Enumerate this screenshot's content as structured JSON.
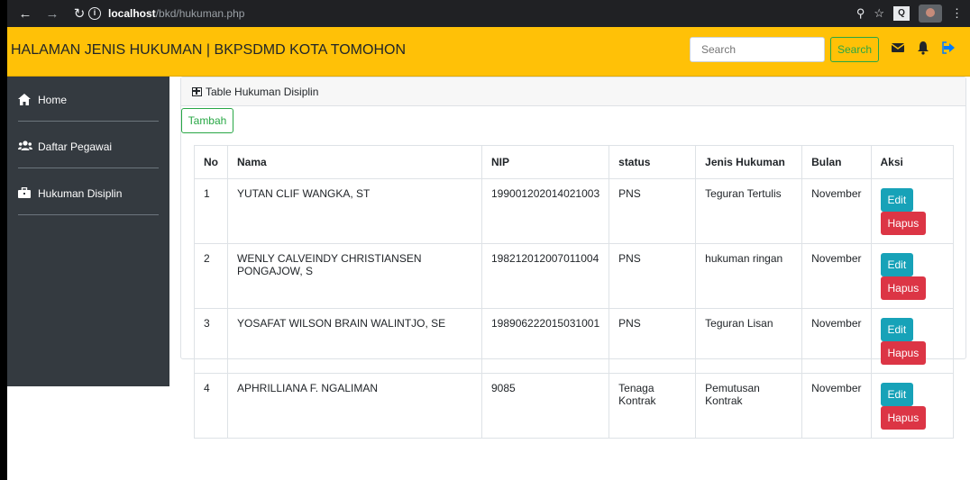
{
  "browser": {
    "host": "localhost",
    "path": "/bkd/hukuman.php"
  },
  "navbar": {
    "brand": "HALAMAN JENIS HUKUMAN | BKPSDMD KOTA TOMOHON",
    "search_placeholder": "Search",
    "search_button": "Search",
    "accent_color": "#ffc107"
  },
  "sidebar": {
    "items": [
      {
        "label": "Home",
        "icon": "home-icon"
      },
      {
        "label": "Daftar Pegawai",
        "icon": "users-icon"
      },
      {
        "label": "Hukuman Disiplin",
        "icon": "briefcase-icon"
      }
    ]
  },
  "card": {
    "header": "Table Hukuman Disiplin",
    "add_button": "Tambah"
  },
  "table": {
    "columns": [
      "No",
      "Nama",
      "NIP",
      "status",
      "Jenis Hukuman",
      "Bulan",
      "Aksi"
    ],
    "edit_label": "Edit",
    "delete_label": "Hapus",
    "rows": [
      {
        "no": "1",
        "nama": "YUTAN CLIF WANGKA, ST",
        "nip": "199001202014021003",
        "status": "PNS",
        "jenis": "Teguran Tertulis",
        "bulan": "November"
      },
      {
        "no": "2",
        "nama": "WENLY CALVEINDY CHRISTIANSEN PONGAJOW, S",
        "nip": "198212012007011004",
        "status": "PNS",
        "jenis": "hukuman ringan",
        "bulan": "November"
      },
      {
        "no": "3",
        "nama": "YOSAFAT WILSON BRAIN WALINTJO, SE",
        "nip": "198906222015031001",
        "status": "PNS",
        "jenis": "Teguran Lisan",
        "bulan": "November"
      },
      {
        "no": "4",
        "nama": "APHRILLIANA F. NGALIMAN",
        "nip": "9085",
        "status": "Tenaga Kontrak",
        "jenis": "Pemutusan Kontrak",
        "bulan": "November"
      }
    ]
  }
}
